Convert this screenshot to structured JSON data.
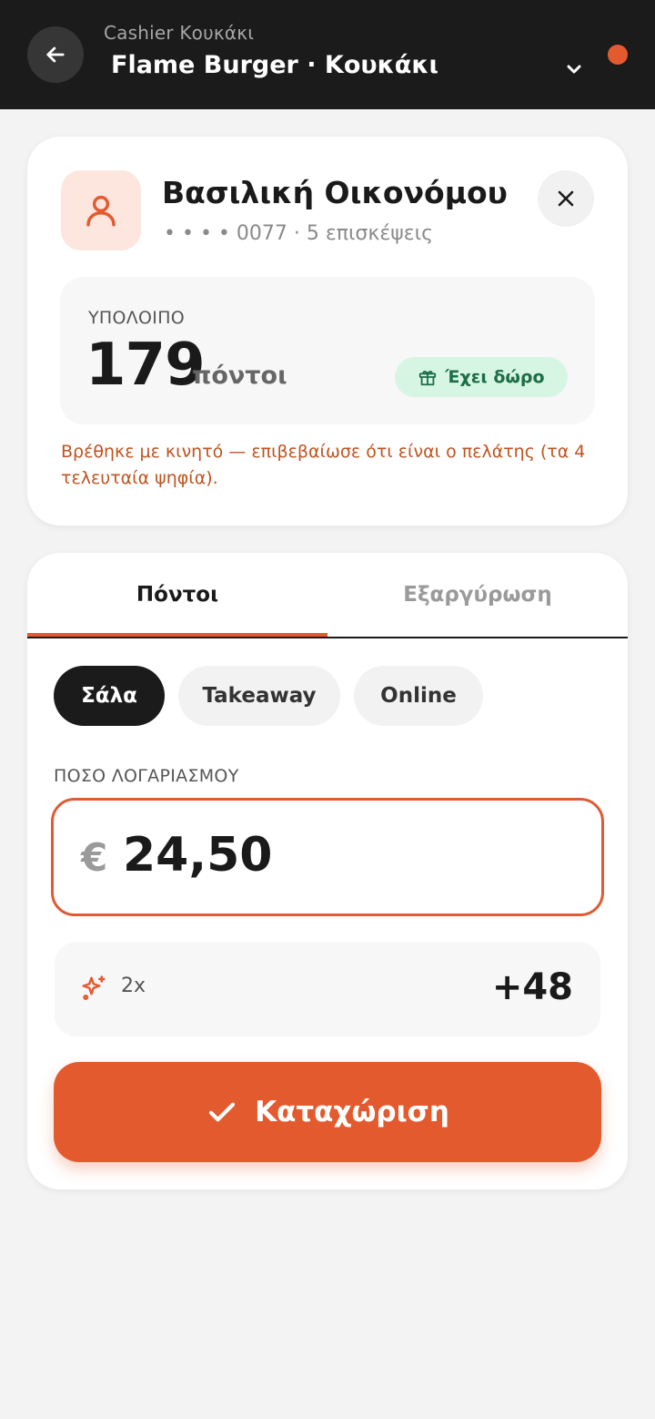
{
  "header": {
    "subtitle": "Cashier Κουκάκι",
    "title": "Flame Burger · Κουκάκι"
  },
  "customer": {
    "name": "Βασιλική Οικονόμου",
    "meta": "• • • • 0077 · 5 επισκέψεις",
    "balance_label": "ΥΠΟΛΟΙΠΟ",
    "balance_value": "179",
    "balance_unit": "πόντοι",
    "gift_badge": "Έχει δώρο",
    "note": "Βρέθηκε με κινητό — επιβεβαίωσε ότι είναι ο πελάτης (τα 4 τελευταία ψηφία)."
  },
  "tabs": [
    {
      "label": "Πόντοι",
      "active": true
    },
    {
      "label": "Εξαργύρωση",
      "active": false
    }
  ],
  "channels": [
    {
      "label": "Σάλα",
      "selected": true
    },
    {
      "label": "Takeaway",
      "selected": false
    },
    {
      "label": "Online",
      "selected": false
    }
  ],
  "amount": {
    "label": "ΠΟΣΟ ΛΟΓΑΡΙΑΣΜΟΥ",
    "currency": "€",
    "value": "24,50"
  },
  "multiplier": {
    "label": "2x",
    "points": "+48"
  },
  "submit_label": "Καταχώριση",
  "colors": {
    "accent": "#e45a2f",
    "header_bg": "#1b1b1b",
    "success_bg": "#d7f5e3",
    "success_text": "#1d6e47"
  }
}
